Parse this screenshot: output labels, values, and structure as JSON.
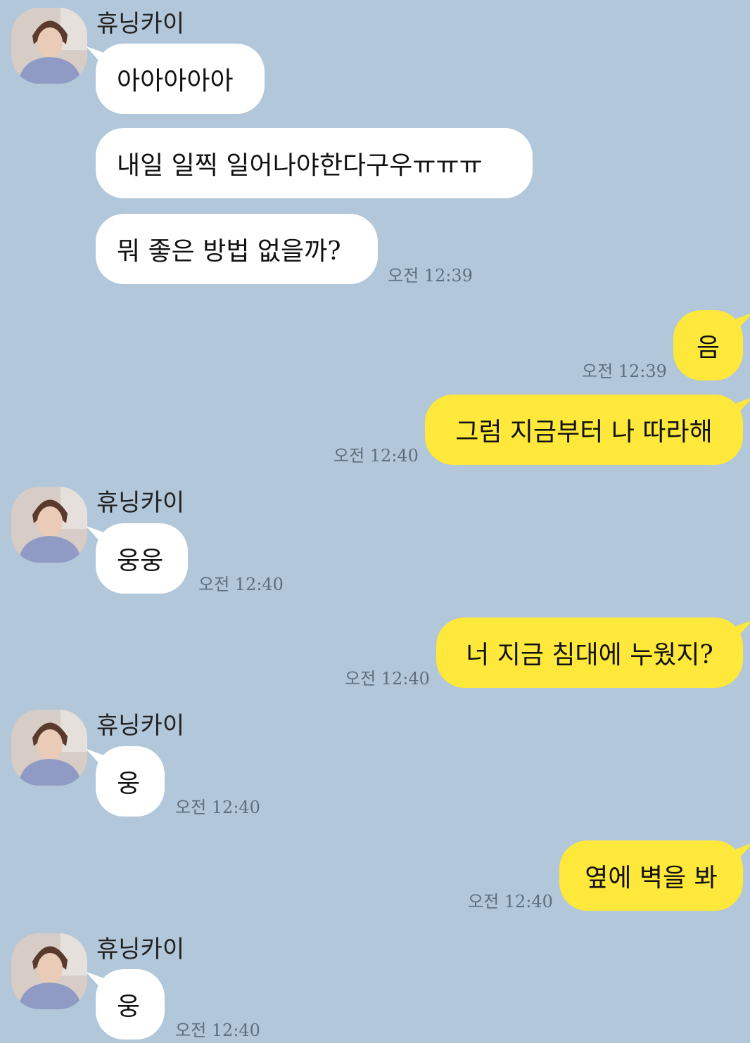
{
  "contact": {
    "name": "휴닝카이"
  },
  "messages": [
    {
      "from": "them",
      "text": "아아아아아"
    },
    {
      "from": "them",
      "text": "내일 일찍 일어나야한다구우ㅠㅠㅠ"
    },
    {
      "from": "them",
      "text": "뭐 좋은 방법 없을까?",
      "time": "오전 12:39"
    },
    {
      "from": "me",
      "text": "음",
      "time": "오전 12:39"
    },
    {
      "from": "me",
      "text": "그럼 지금부터 나 따라해",
      "time": "오전 12:40"
    },
    {
      "from": "them",
      "text": "웅웅",
      "time": "오전 12:40"
    },
    {
      "from": "me",
      "text": "너 지금 침대에 누웠지?",
      "time": "오전 12:40"
    },
    {
      "from": "them",
      "text": "웅",
      "time": "오전 12:40"
    },
    {
      "from": "me",
      "text": "옆에 벽을 봐",
      "time": "오전 12:40"
    },
    {
      "from": "them",
      "text": "웅",
      "time": "오전 12:40"
    }
  ],
  "colors": {
    "background": "#b2c7d9",
    "incoming_bubble": "#ffffff",
    "outgoing_bubble": "#fee83b",
    "timestamp": "#5f6e7c"
  }
}
